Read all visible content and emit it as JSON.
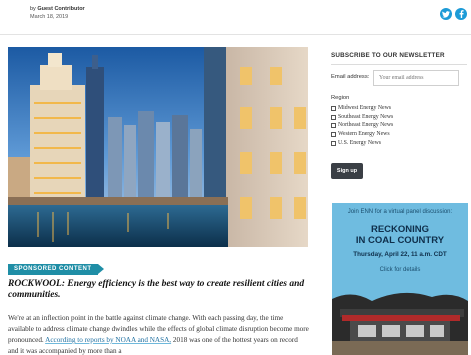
{
  "article": {
    "byline_prefix": "by",
    "author": "Guest Contributor",
    "date": "March 18, 2019",
    "badge": "SPONSORED CONTENT",
    "headline": "ROCKWOOL: Energy efficiency is the best way to create resilient cities and communities.",
    "paragraph_text": "We're at an inflection point in the battle against climate change. With each passing day, the time available to address climate change dwindles while the effects of global climate disruption become more pronounced.",
    "paragraph_link": "According to reports by NOAA and NASA,",
    "paragraph_tail": "2018 was one of the hottest years on record and it was accompanied by more than a"
  },
  "share": {
    "icons": [
      "twitter-icon",
      "facebook-icon"
    ],
    "color": "#1d9bd7"
  },
  "newsletter": {
    "title": "SUBSCRIBE TO OUR NEWSLETTER",
    "email_label": "Email address:",
    "email_placeholder": "Your email address",
    "region_label": "Region",
    "regions": [
      "Midwest Energy News",
      "Southeast Energy News",
      "Northeast Energy News",
      "Western Energy News",
      "U.S. Energy News"
    ],
    "signup_label": "Sign up"
  },
  "ad": {
    "line1": "Join ENN for a virtual panel discussion:",
    "line2a": "RECKONING",
    "line2b": "IN COAL COUNTRY",
    "line3": "Thursday, April 22, 11 a.m. CDT",
    "line4": "Click for details",
    "bg_color": "#6fbce0"
  },
  "colors": {
    "accent": "#1f8ea6",
    "link": "#1f6fa0"
  }
}
